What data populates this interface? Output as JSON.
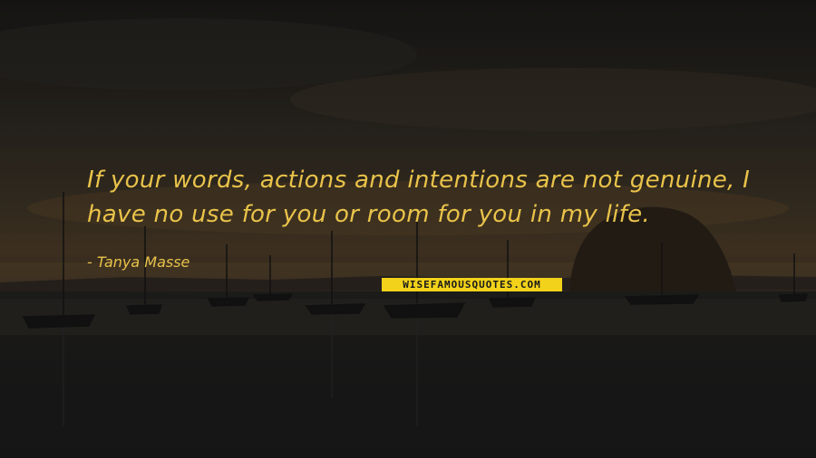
{
  "quote": {
    "text": "If your words, actions and intentions are not genuine, I have no use for you or room for you in my life.",
    "author": "- Tanya Masse"
  },
  "watermark": {
    "label": "WISEFAMOUSQUOTES.COM"
  },
  "colors": {
    "quote_text": "#e9c34a",
    "watermark_bg": "#f2d21a"
  },
  "background": {
    "description_icon": "harbor-sunset-photo"
  }
}
